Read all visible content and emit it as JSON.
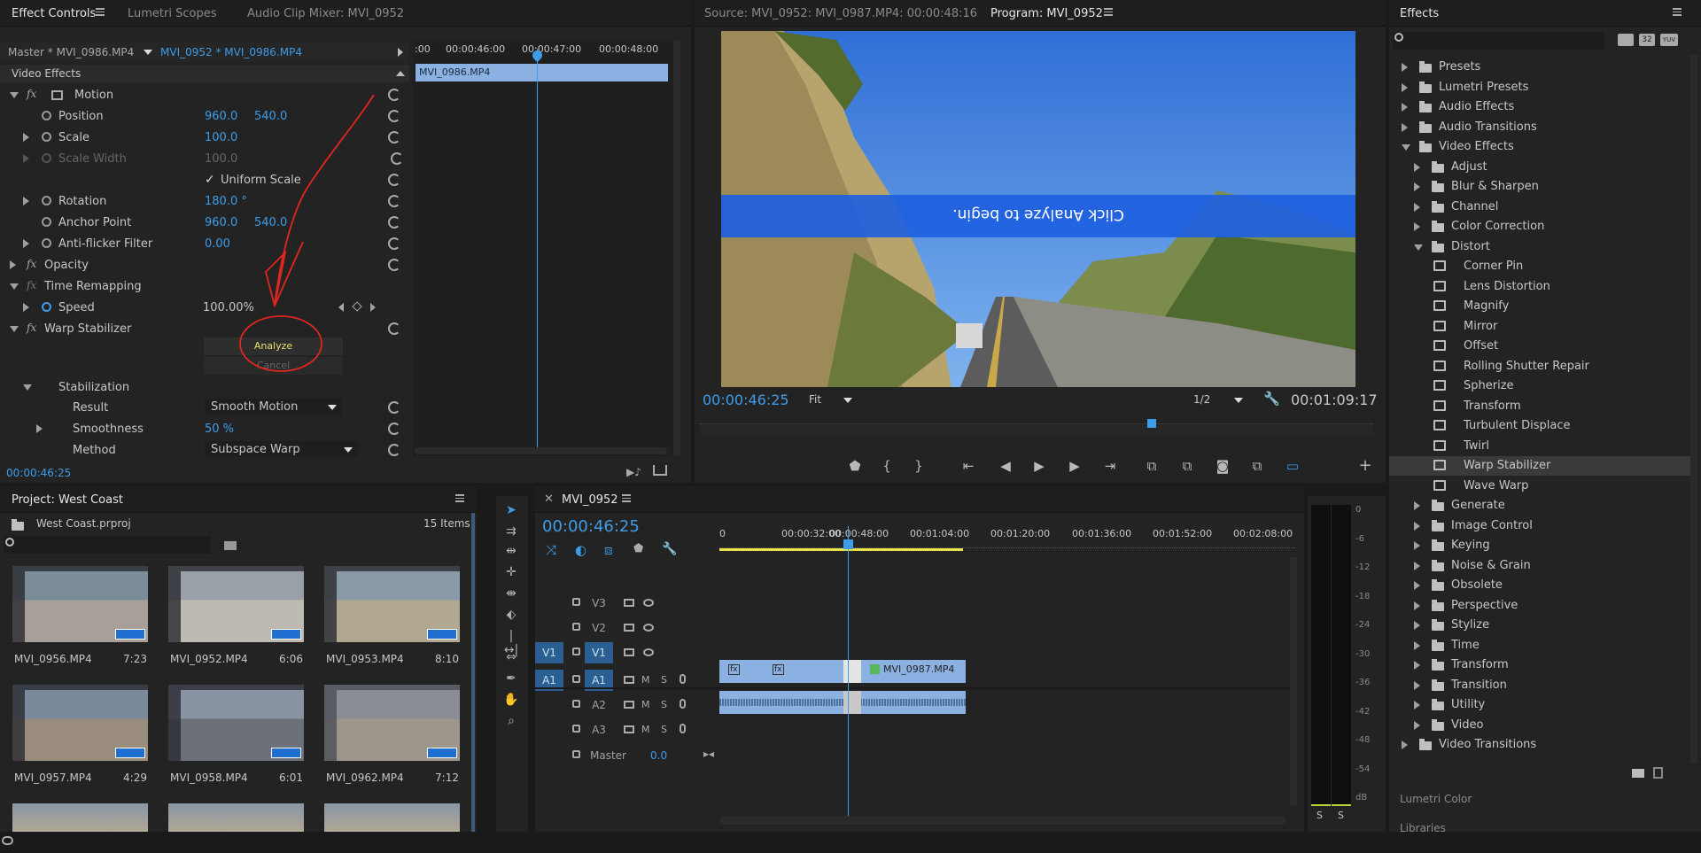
{
  "effect_controls": {
    "tabs": [
      "Effect Controls",
      "Lumetri Scopes",
      "Audio Clip Mixer: MVI_0952"
    ],
    "master_clip": "Master * MVI_0986.MP4",
    "active_clip": "MVI_0952 * MVI_0986.MP4",
    "section_title": "Video Effects",
    "motion_label": "Motion",
    "position_label": "Position",
    "position_x": "960.0",
    "position_y": "540.0",
    "scale_label": "Scale",
    "scale_value": "100.0",
    "scale_width_label": "Scale Width",
    "scale_width_value": "100.0",
    "uniform_scale_label": "Uniform Scale",
    "rotation_label": "Rotation",
    "rotation_value": "180.0 °",
    "anchor_label": "Anchor Point",
    "anchor_x": "960.0",
    "anchor_y": "540.0",
    "antiflicker_label": "Anti-flicker Filter",
    "antiflicker_value": "0.00",
    "opacity_label": "Opacity",
    "time_remap_label": "Time Remapping",
    "speed_label": "Speed",
    "speed_value": "100.00%",
    "warp_label": "Warp Stabilizer",
    "analyze_label": "Analyze",
    "cancel_label": "Cancel",
    "stabilization_label": "Stabilization",
    "result_label": "Result",
    "result_value": "Smooth Motion",
    "smoothness_label": "Smoothness",
    "smoothness_value": "50 %",
    "method_label": "Method",
    "method_value": "Subspace Warp",
    "timecode": "00:00:46:25",
    "mini_ruler": [
      ":00",
      "00:00:46:00",
      "00:00:47:00",
      "00:00:48:00"
    ],
    "mini_clip": "MVI_0986.MP4"
  },
  "source_monitor": {
    "tab_label": "Source: MVI_0952: MVI_0987.MP4: 00:00:48:16"
  },
  "program_monitor": {
    "tab_label": "Program: MVI_0952",
    "overlay_text": "Click Analyze to begin.",
    "timecode": "00:00:46:25",
    "fit_value": "Fit",
    "resolution_value": "1/2",
    "duration": "00:01:09:17",
    "plus_label": "+"
  },
  "effects": {
    "title": "Effects",
    "presets_badges": [
      "32",
      "YUV"
    ],
    "tree": [
      {
        "label": "Presets",
        "level": 0,
        "open": false
      },
      {
        "label": "Lumetri Presets",
        "level": 0,
        "open": false
      },
      {
        "label": "Audio Effects",
        "level": 0,
        "open": false
      },
      {
        "label": "Audio Transitions",
        "level": 0,
        "open": false
      },
      {
        "label": "Video Effects",
        "level": 0,
        "open": true
      },
      {
        "label": "Adjust",
        "level": 1,
        "open": false
      },
      {
        "label": "Blur & Sharpen",
        "level": 1,
        "open": false
      },
      {
        "label": "Channel",
        "level": 1,
        "open": false
      },
      {
        "label": "Color Correction",
        "level": 1,
        "open": false
      },
      {
        "label": "Distort",
        "level": 1,
        "open": true
      },
      {
        "label": "Corner Pin",
        "level": 2
      },
      {
        "label": "Lens Distortion",
        "level": 2
      },
      {
        "label": "Magnify",
        "level": 2
      },
      {
        "label": "Mirror",
        "level": 2
      },
      {
        "label": "Offset",
        "level": 2
      },
      {
        "label": "Rolling Shutter Repair",
        "level": 2
      },
      {
        "label": "Spherize",
        "level": 2
      },
      {
        "label": "Transform",
        "level": 2
      },
      {
        "label": "Turbulent Displace",
        "level": 2
      },
      {
        "label": "Twirl",
        "level": 2
      },
      {
        "label": "Warp Stabilizer",
        "level": 2,
        "selected": true
      },
      {
        "label": "Wave Warp",
        "level": 2
      },
      {
        "label": "Generate",
        "level": 1,
        "open": false
      },
      {
        "label": "Image Control",
        "level": 1,
        "open": false
      },
      {
        "label": "Keying",
        "level": 1,
        "open": false
      },
      {
        "label": "Noise & Grain",
        "level": 1,
        "open": false
      },
      {
        "label": "Obsolete",
        "level": 1,
        "open": false
      },
      {
        "label": "Perspective",
        "level": 1,
        "open": false
      },
      {
        "label": "Stylize",
        "level": 1,
        "open": false
      },
      {
        "label": "Time",
        "level": 1,
        "open": false
      },
      {
        "label": "Transform",
        "level": 1,
        "open": false
      },
      {
        "label": "Transition",
        "level": 1,
        "open": false
      },
      {
        "label": "Utility",
        "level": 1,
        "open": false
      },
      {
        "label": "Video",
        "level": 1,
        "open": false
      },
      {
        "label": "Video Transitions",
        "level": 0,
        "open": false
      }
    ],
    "lumetri_color": "Lumetri Color",
    "libraries": "Libraries"
  },
  "project": {
    "title": "Project: West Coast",
    "file": "West Coast.prproj",
    "count": "15 Items",
    "clips": [
      {
        "name": "MVI_0956.MP4",
        "duration": "7:23"
      },
      {
        "name": "MVI_0952.MP4",
        "duration": "6:06"
      },
      {
        "name": "MVI_0953.MP4",
        "duration": "8:10"
      },
      {
        "name": "MVI_0957.MP4",
        "duration": "4:29"
      },
      {
        "name": "MVI_0958.MP4",
        "duration": "6:01"
      },
      {
        "name": "MVI_0962.MP4",
        "duration": "7:12"
      }
    ]
  },
  "timeline": {
    "sequence_name": "MVI_0952",
    "timecode": "00:00:46:25",
    "ruler": [
      "0",
      "00:00:32:00",
      "00:00:48:00",
      "00:01:04:00",
      "00:01:20:00",
      "00:01:36:00",
      "00:01:52:00",
      "00:02:08:00"
    ],
    "tracks": [
      {
        "patch": "",
        "name": "V3",
        "type": "video"
      },
      {
        "patch": "",
        "name": "V2",
        "type": "video"
      },
      {
        "patch": "V1",
        "name": "V1",
        "type": "video"
      },
      {
        "patch": "A1",
        "name": "A1",
        "type": "audio"
      },
      {
        "patch": "",
        "name": "A2",
        "type": "audio"
      },
      {
        "patch": "",
        "name": "A3",
        "type": "audio"
      }
    ],
    "m_label": "M",
    "s_label": "S",
    "master_label": "Master",
    "master_value": "0.0",
    "clip_name": "MVI_0987.MP4",
    "fx_badge": "fx"
  },
  "audio_meter": {
    "scale": [
      "0",
      "-6",
      "-12",
      "-18",
      "-24",
      "-30",
      "-36",
      "-42",
      "-48",
      "-54",
      "dB"
    ],
    "solo": [
      "S",
      "S"
    ]
  }
}
